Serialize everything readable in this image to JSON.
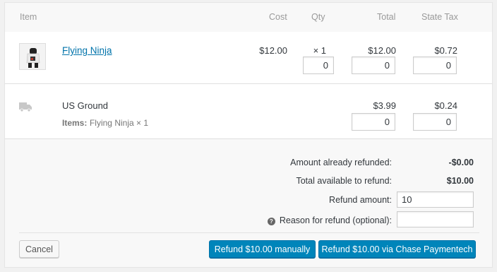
{
  "columns": {
    "item": "Item",
    "cost": "Cost",
    "qty": "Qty",
    "total": "Total",
    "tax": "State Tax"
  },
  "product": {
    "name": "Flying Ninja",
    "cost": "$12.00",
    "qty": "× 1",
    "total": "$12.00",
    "tax": "$0.72",
    "refund_qty": "0",
    "refund_total": "0",
    "refund_tax": "0",
    "thumbnail_icon": "product-thumbnail"
  },
  "shipping": {
    "name": "US Ground",
    "items_label": "Items:",
    "items_value": "Flying Ninja × 1",
    "total": "$3.99",
    "tax": "$0.24",
    "refund_total": "0",
    "refund_tax": "0",
    "icon": "truck-icon"
  },
  "refund": {
    "already_refunded_label": "Amount already refunded:",
    "already_refunded_value": "-$0.00",
    "available_label": "Total available to refund:",
    "available_value": "$10.00",
    "amount_label": "Refund amount:",
    "amount_value": "10",
    "reason_label": "Reason for refund (optional):",
    "reason_value": "",
    "help_icon": "?"
  },
  "buttons": {
    "cancel": "Cancel",
    "manual": "Refund $10.00 manually",
    "gateway": "Refund $10.00 via Chase Paymentech"
  },
  "colors": {
    "primary": "#0085ba",
    "link": "#0073aa"
  }
}
